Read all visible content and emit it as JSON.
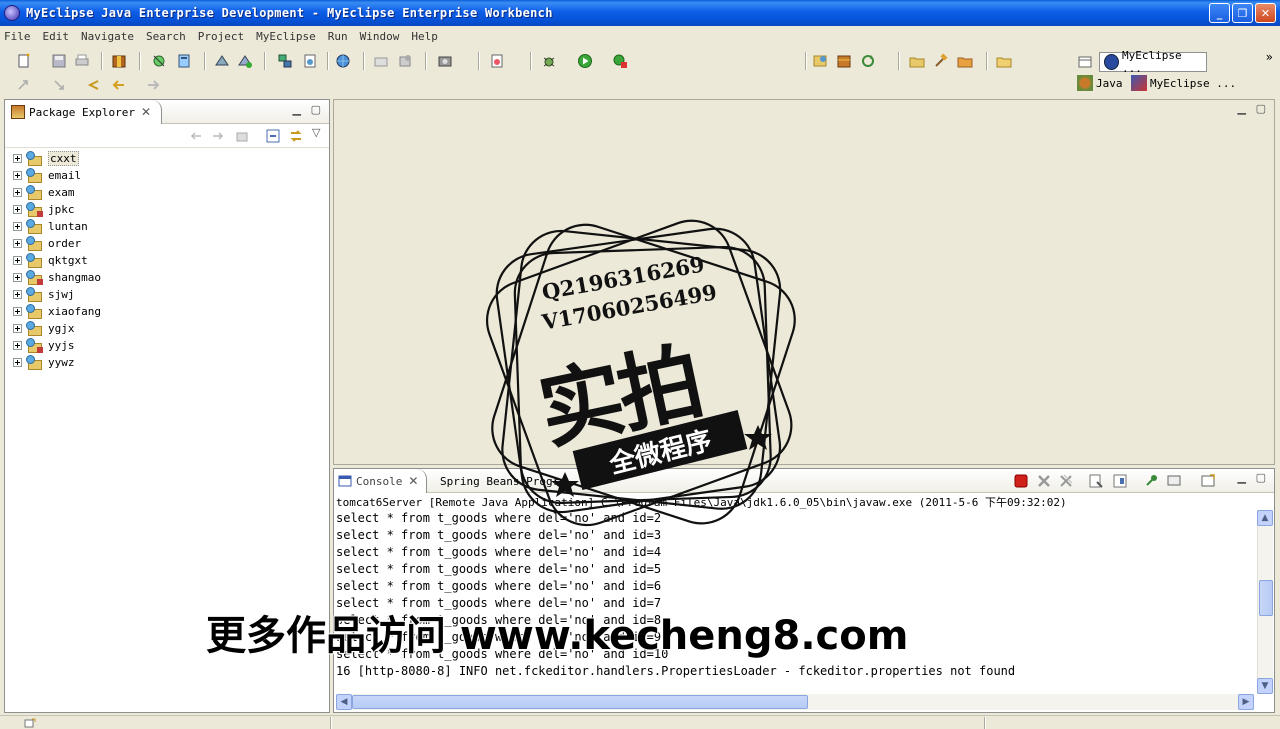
{
  "window": {
    "title": "MyEclipse Java Enterprise Development - MyEclipse Enterprise Workbench",
    "minimize": "_",
    "maximize": "❐",
    "close": "✕"
  },
  "menu": [
    "File",
    "Edit",
    "Navigate",
    "Search",
    "Project",
    "MyEclipse",
    "Run",
    "Window",
    "Help"
  ],
  "perspectives": {
    "active": "MyEclipse ...",
    "java": "Java",
    "other": "MyEclipse ..."
  },
  "package_explorer": {
    "title": "Package Explorer",
    "close": "✕",
    "projects": [
      "cxxt",
      "email",
      "exam",
      "jpkc",
      "luntan",
      "order",
      "qktgxt",
      "shangmao",
      "sjwj",
      "xiaofang",
      "ygjx",
      "yyjs",
      "yywz"
    ],
    "selected": "cxxt"
  },
  "console": {
    "tab_label": "Console",
    "close": "✕",
    "tab2_label": "Spring Beans Progre",
    "description": "tomcat6Server [Remote Java Application] C:\\Program Files\\Java\\jdk1.6.0_05\\bin\\javaw.exe (2011-5-6 下午09:32:02)",
    "lines": [
      "select * from t_goods where del='no' and id=2",
      "select * from t_goods where del='no' and id=3",
      "select * from t_goods where del='no' and id=4",
      "select * from t_goods where del='no' and id=5",
      "select * from t_goods where del='no' and id=6",
      "select * from t_goods where del='no' and id=7",
      "select * from t_goods where del='no' and id=8",
      "select * from t_goods where del='no' and id=9",
      "select * from t_goods where del='no' and id=10",
      "16 [http-8080-8] INFO net.fckeditor.handlers.PropertiesLoader - fckeditor.properties not found"
    ]
  },
  "watermark": {
    "qq": "Q2196316269",
    "wechat": "V17060256499",
    "big": "实拍",
    "ribbon": "全微程序",
    "overlay": "更多作品访问 www.kecheng8.com"
  },
  "colors": {
    "titlebar": "#0a5fd8",
    "stop_button": "#d0211a"
  }
}
